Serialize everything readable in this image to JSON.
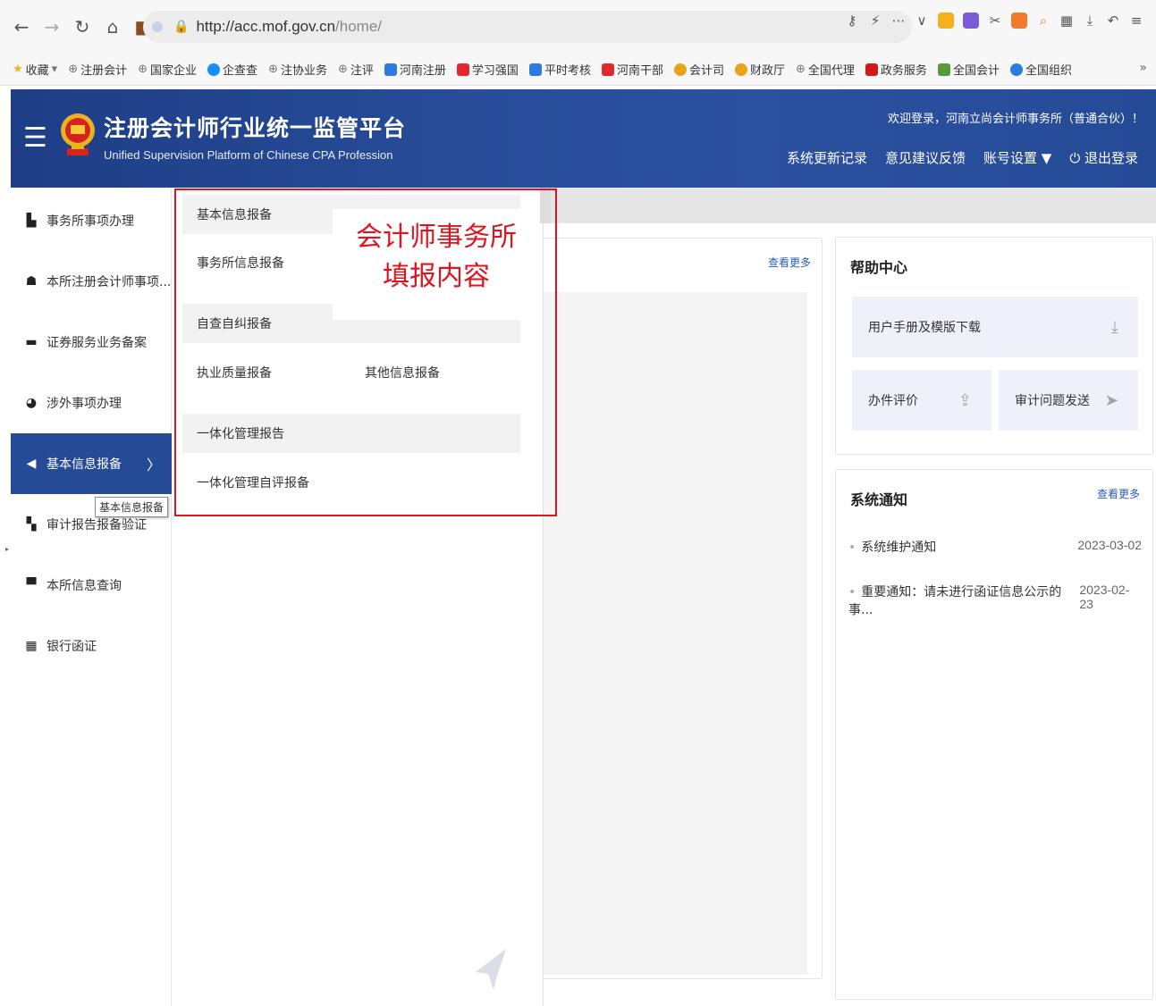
{
  "browser": {
    "url_host": "http://acc.mof.gov.cn",
    "url_path": "/home/",
    "bookmarks": [
      {
        "label": "收藏",
        "icon": "star-icon"
      },
      {
        "label": "注册会计",
        "icon": "globe-icon"
      },
      {
        "label": "国家企业",
        "icon": "globe-icon"
      },
      {
        "label": "企查查",
        "icon": "qcc-icon"
      },
      {
        "label": "注协业务",
        "icon": "globe-icon"
      },
      {
        "label": "注评",
        "icon": "globe-icon"
      },
      {
        "label": "河南注册",
        "icon": "blue-square-icon"
      },
      {
        "label": "学习强国",
        "icon": "red-square-icon"
      },
      {
        "label": "平时考核",
        "icon": "blue-square-icon"
      },
      {
        "label": "河南干部",
        "icon": "red-square-icon"
      },
      {
        "label": "会计司",
        "icon": "emblem-icon"
      },
      {
        "label": "财政厅",
        "icon": "emblem-icon"
      },
      {
        "label": "全国代理",
        "icon": "globe-icon"
      },
      {
        "label": "政务服务",
        "icon": "red-square-icon"
      },
      {
        "label": "全国会计",
        "icon": "doc-icon"
      },
      {
        "label": "全国组织",
        "icon": "blue-square-icon"
      }
    ]
  },
  "header": {
    "title": "注册会计师行业统一监管平台",
    "subtitle": "Unified Supervision Platform of Chinese CPA Profession",
    "welcome": "欢迎登录，河南立尚会计师事务所（普通合伙）！",
    "links": {
      "update_log": "系统更新记录",
      "feedback": "意见建议反馈",
      "account": "账号设置",
      "logout": "退出登录"
    }
  },
  "sidebar": {
    "items": [
      {
        "label": "事务所事项办理",
        "icon": "building-icon"
      },
      {
        "label": "本所注册会计师事项...",
        "icon": "user-icon"
      },
      {
        "label": "证券服务业务备案",
        "icon": "folder-icon"
      },
      {
        "label": "涉外事项办理",
        "icon": "globe-icon"
      },
      {
        "label": "基本信息报备",
        "icon": "send-icon"
      },
      {
        "label": "审计报告报备验证",
        "icon": "grid-icon"
      },
      {
        "label": "本所信息查询",
        "icon": "monitor-icon"
      },
      {
        "label": "银行函证",
        "icon": "bank-icon"
      }
    ],
    "tooltip": "基本信息报备"
  },
  "mega_menu": {
    "group_basic": "基本信息报备",
    "link_firm_info": "事务所信息报备",
    "group_self_check": "自查自纠报备",
    "link_quality": "执业质量报备",
    "link_other": "其他信息报备",
    "group_integrated": "一体化管理报告",
    "link_self_eval": "一体化管理自评报备"
  },
  "annotation": {
    "line1": "会计师事务所",
    "line2": "填报内容"
  },
  "main": {
    "more_label": "查看更多"
  },
  "help_center": {
    "title": "帮助中心",
    "manual": "用户手册及模版下载",
    "evaluation": "办件评价",
    "audit_issue": "审计问题发送"
  },
  "notices": {
    "title": "系统通知",
    "more": "查看更多",
    "items": [
      {
        "title": "系统维护通知",
        "date": "2023-03-02"
      },
      {
        "title": "重要通知：请未进行函证信息公示的事...",
        "date": "2023-02-23"
      }
    ]
  },
  "colors": {
    "brand_blue": "#254a96",
    "annotation_red": "#e0141e"
  }
}
